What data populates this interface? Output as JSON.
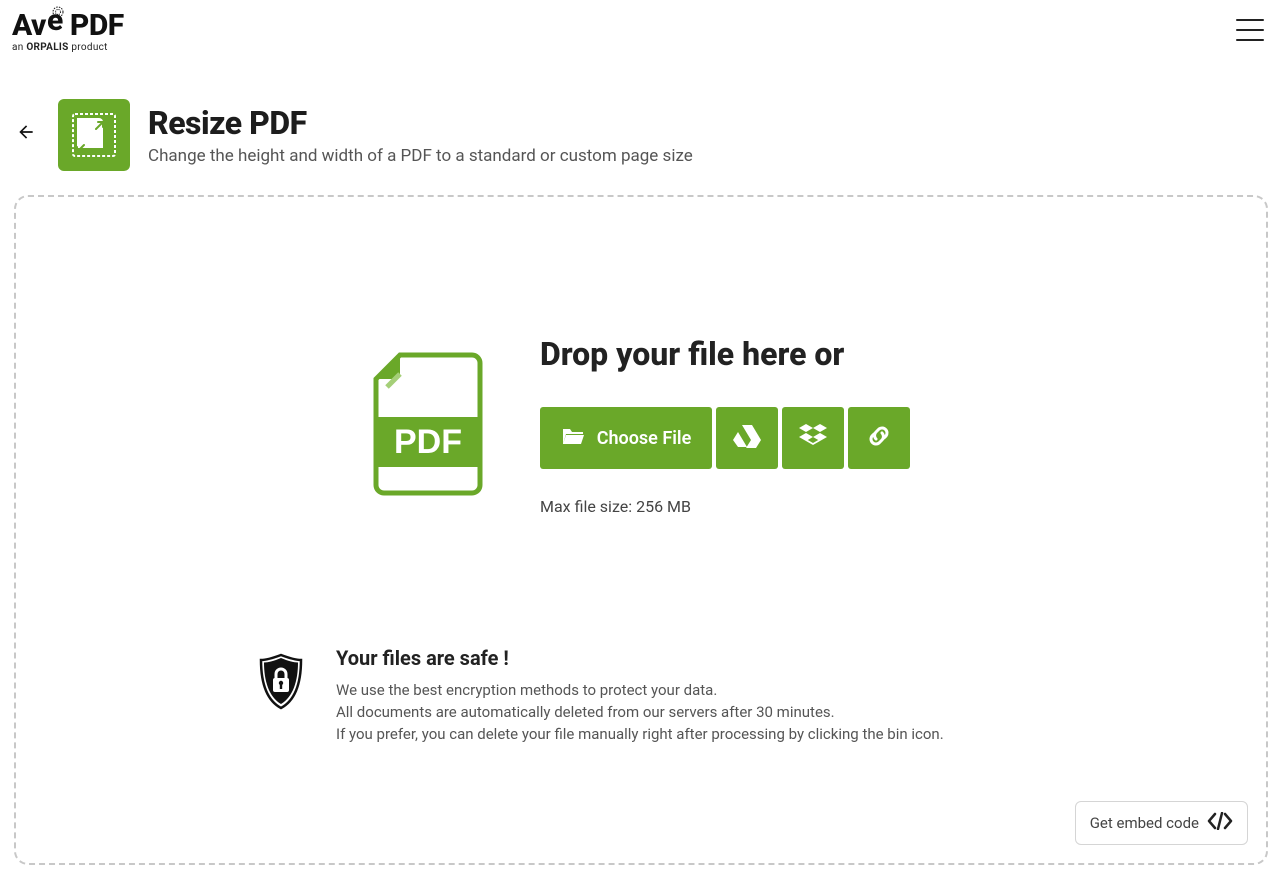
{
  "brand": {
    "name_part1": "Av",
    "name_part2": "PDF",
    "tagline_prefix": "an ",
    "tagline_brand": "ORPALIS",
    "tagline_suffix": " product"
  },
  "tool": {
    "title": "Resize PDF",
    "subtitle": "Change the height and width of a PDF to a standard or custom page size"
  },
  "drop": {
    "heading": "Drop your file here or",
    "choose_label": "Choose File",
    "max_note": "Max file size: 256 MB"
  },
  "safe": {
    "heading": "Your files are safe !",
    "line1": "We use the best encryption methods to protect your data.",
    "line2": "All documents are automatically deleted from our servers after 30 minutes.",
    "line3": "If you prefer, you can delete your file manually right after processing by clicking the bin icon."
  },
  "embed": {
    "label": "Get embed code"
  }
}
